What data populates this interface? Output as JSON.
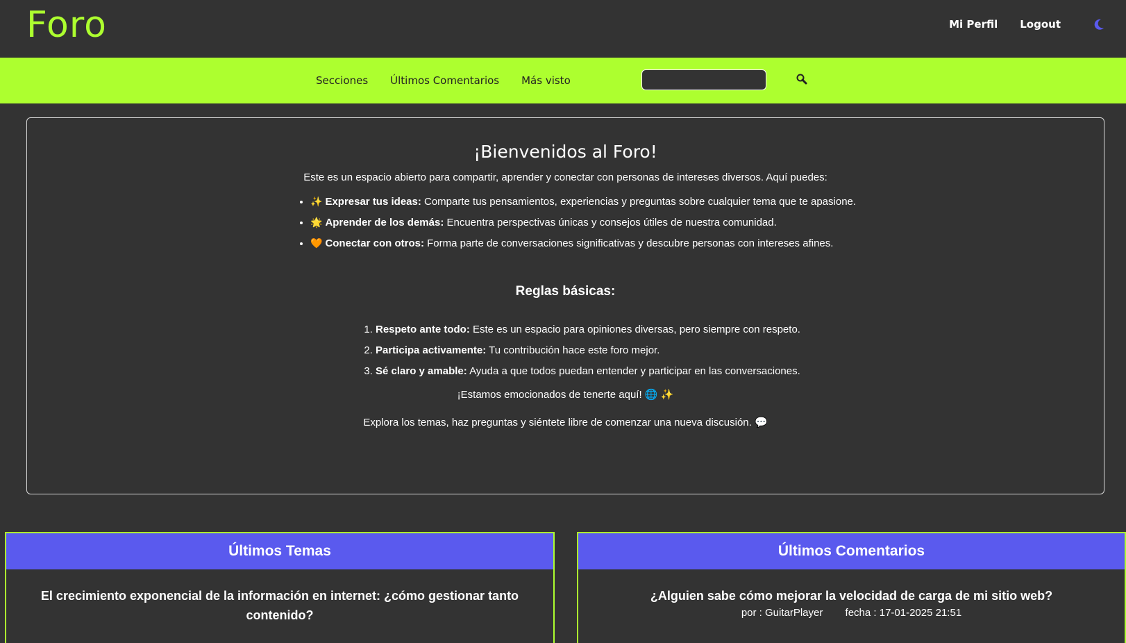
{
  "header": {
    "logo": "Foro",
    "profile_link": "Mi Perfil",
    "logout_link": "Logout",
    "theme_icon": "moon-icon",
    "accent_color": "#adff2f",
    "moon_color": "#5a5aee"
  },
  "nav": {
    "items": [
      "Secciones",
      "Últimos Comentarios",
      "Más visto"
    ],
    "search_placeholder": "",
    "search_icon": "search-icon"
  },
  "welcome": {
    "title": "¡Bienvenidos al Foro!",
    "intro": "Este es un espacio abierto para compartir, aprender y conectar con personas de intereses diversos. Aquí puedes:",
    "features": [
      {
        "emoji": "✨",
        "bold": "Expresar tus ideas:",
        "text": " Comparte tus pensamientos, experiencias y preguntas sobre cualquier tema que te apasione."
      },
      {
        "emoji": "🌟",
        "bold": "Aprender de los demás:",
        "text": " Encuentra perspectivas únicas y consejos útiles de nuestra comunidad."
      },
      {
        "emoji": "🧡",
        "bold": "Conectar con otros:",
        "text": " Forma parte de conversaciones significativas y descubre personas con intereses afines."
      }
    ],
    "rules_title": "Reglas básicas:",
    "rules": [
      {
        "bold": "Respeto ante todo:",
        "text": " Este es un espacio para opiniones diversas, pero siempre con respeto."
      },
      {
        "bold": "Participa activamente:",
        "text": " Tu contribución hace este foro mejor."
      },
      {
        "bold": "Sé claro y amable:",
        "text": " Ayuda a que todos puedan entender y participar en las conversaciones."
      }
    ],
    "closing1": "¡Estamos emocionados de tenerte aquí! 🌐 ✨",
    "closing2": "Explora los temas, haz preguntas y siéntete libre de comenzar una nueva discusión. 💬"
  },
  "latest_topics": {
    "title": "Últimos Temas",
    "first_topic": "El crecimiento exponencial de la información en internet: ¿cómo gestionar tanto contenido?"
  },
  "latest_comments": {
    "title": "Últimos Comentarios",
    "first_title": "¿Alguien sabe cómo mejorar la velocidad de carga de mi sitio web?",
    "first_author": "por : GuitarPlayer",
    "first_date": "fecha : 17-01-2025 21:51"
  }
}
